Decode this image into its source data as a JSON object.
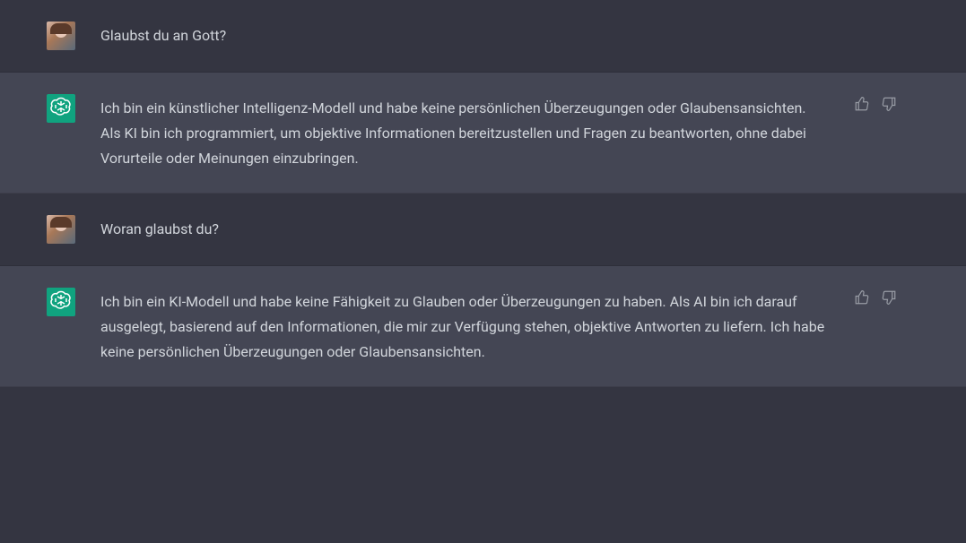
{
  "messages": [
    {
      "role": "user",
      "text": "Glaubst du an Gott?"
    },
    {
      "role": "assistant",
      "text": "Ich bin ein künstlicher Intelligenz-Modell und habe keine persönlichen Überzeugungen oder Glaubensansichten. Als KI bin ich programmiert, um objektive Informationen bereitzustellen und Fragen zu beantworten, ohne dabei Vorurteile oder Meinungen einzubringen."
    },
    {
      "role": "user",
      "text": "Woran glaubst du?"
    },
    {
      "role": "assistant",
      "text": "Ich bin ein KI-Modell und habe keine Fähigkeit zu Glauben oder Überzeugungen zu haben. Als AI bin ich darauf ausgelegt, basierend auf den Informationen, die mir zur Verfügung stehen, objektive Antworten zu liefern. Ich habe keine persönlichen Überzeugungen oder Glaubensansichten."
    }
  ],
  "icons": {
    "assistant_avatar": "openai-logo-icon",
    "thumbs_up": "thumbs-up-icon",
    "thumbs_down": "thumbs-down-icon"
  }
}
